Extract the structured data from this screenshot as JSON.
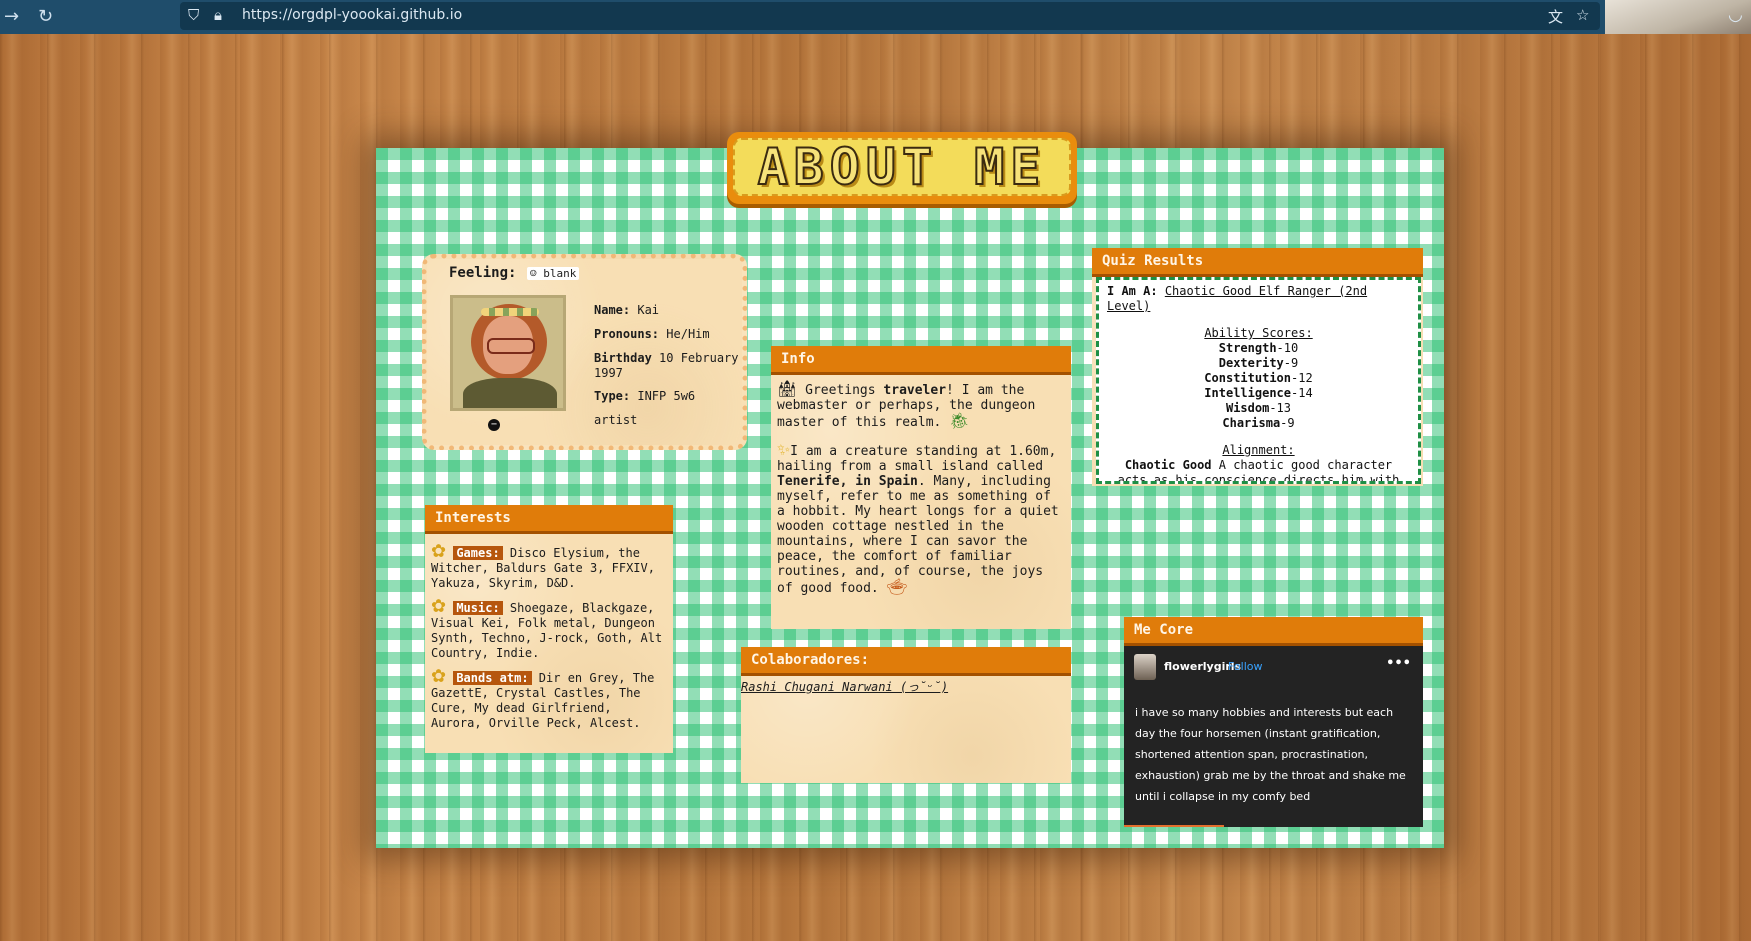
{
  "browser": {
    "url": "https://orgdpl-yoookai.github.io",
    "icons": {
      "forward": "arrow-right-icon",
      "reload": "reload-icon",
      "shield": "shield-icon",
      "lock": "lock-icon",
      "translate": "translate-icon",
      "star": "star-icon",
      "pocket": "pocket-icon"
    }
  },
  "title": "ABOUT ME",
  "profile": {
    "feeling_label": "Feeling:",
    "feeling_status": "blank",
    "name_label": "Name:",
    "name": "Kai",
    "pronouns_label": "Pronouns:",
    "pronouns": "He/Him",
    "birthday_label": "Birthday",
    "birthday": "10 February 1997",
    "type_label": "Type:",
    "type": "INFP 5w6",
    "extra": "artist"
  },
  "info": {
    "header": "Info",
    "p1_pre": "Greetings ",
    "p1_bold": "traveler",
    "p1_post": "! I am the webmaster or perhaps, the dungeon master of this realm.",
    "p2_pre": "I am a creature standing at 1.60m, hailing from a small island called ",
    "p2_bold": "Tenerife, in Spain",
    "p2_post": ". Many, including myself, refer to me as something of a hobbit. My heart longs for a quiet wooden cottage nestled in the mountains, where I can savor the peace, the comfort of familiar routines, and, of course, the joys of good food."
  },
  "quiz": {
    "header": "Quiz Results",
    "iam_label": "I Am A:",
    "iam_value": "Chaotic Good Elf Ranger (2nd Level)",
    "ability_title": "Ability Scores:",
    "abilities": [
      {
        "name": "Strength",
        "value": "-10"
      },
      {
        "name": "Dexterity",
        "value": "-9"
      },
      {
        "name": "Constitution",
        "value": "-12"
      },
      {
        "name": "Intelligence",
        "value": "-14"
      },
      {
        "name": "Wisdom",
        "value": "-13"
      },
      {
        "name": "Charisma",
        "value": "-9"
      }
    ],
    "alignment_title": "Alignment:",
    "alignment_bold": "Chaotic Good",
    "alignment_text": " A chaotic good character acts as his conscience directs him with little regard for what others expect of him. He"
  },
  "interests": {
    "header": "Interests",
    "items": [
      {
        "tag": "Games:",
        "text": " Disco Elysium, the Witcher, Baldurs Gate 3, FFXIV, Yakuza, Skyrim, D&D."
      },
      {
        "tag": "Music:",
        "text": " Shoegaze, Blackgaze, Visual Kei, Folk metal, Dungeon Synth, Techno, J-rock, Goth, Alt Country, Indie."
      },
      {
        "tag": "Bands atm:",
        "text": " Dir en Grey, The GazettE, Crystal Castles, The Cure, My dead Girlfriend, Aurora, Orville Peck, Alcest."
      }
    ]
  },
  "colab": {
    "header": "Colaboradores:",
    "link": "Rashi Chugani Narwani  (っ˘ᵕ˘)"
  },
  "mecore": {
    "header": "Me Core",
    "username": "flowerlygirls",
    "follow": "Follow",
    "more": "•••",
    "post": "i have so many hobbies and interests but each day the four horsemen (instant gratification, shortened attention span, procrastination, exhaustion) grab me by the throat and shake me until i collapse in my comfy bed"
  }
}
